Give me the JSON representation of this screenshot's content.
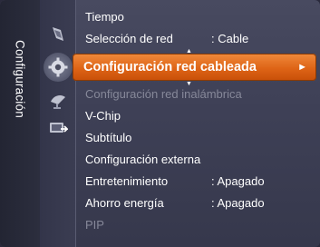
{
  "sidebar": {
    "title": "Configuración"
  },
  "icons": [
    {
      "name": "picture-icon",
      "active": false
    },
    {
      "name": "setup-gear-icon",
      "active": true
    },
    {
      "name": "satellite-dish-icon",
      "active": false
    },
    {
      "name": "input-source-icon",
      "active": false
    }
  ],
  "menu": {
    "items": [
      {
        "label": "Tiempo",
        "value": ""
      },
      {
        "label": "Selección de red",
        "value": ": Cable"
      },
      {
        "label": "Configuración red cableada",
        "value": "",
        "selected": true,
        "arrow": "►"
      },
      {
        "label": "Configuración red inalámbrica",
        "value": "",
        "disabled": true
      },
      {
        "label": "V-Chip",
        "value": ""
      },
      {
        "label": "Subtítulo",
        "value": ""
      },
      {
        "label": "Configuración externa",
        "value": ""
      },
      {
        "label": "Entretenimiento",
        "value": ": Apagado"
      },
      {
        "label": "Ahorro energía",
        "value": ": Apagado"
      },
      {
        "label": "PIP",
        "value": "",
        "disabled": true
      }
    ]
  },
  "colors": {
    "selected_highlight": "#de6416",
    "background": "#3e4056",
    "disabled_text": "#868899"
  }
}
